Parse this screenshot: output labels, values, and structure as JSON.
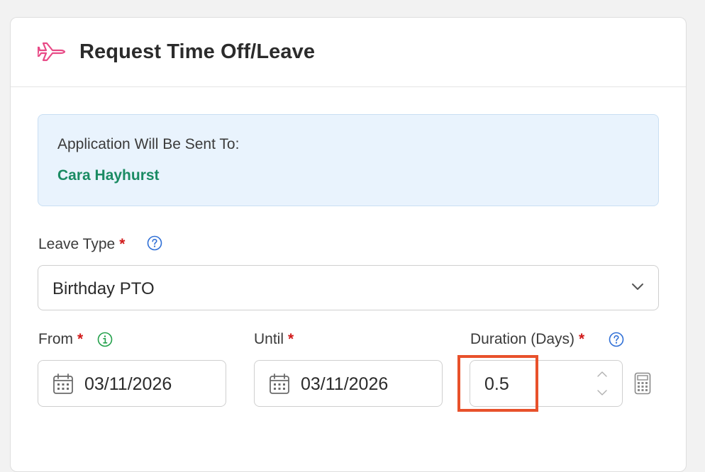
{
  "header": {
    "title": "Request Time Off/Leave",
    "icon": "airplane-icon",
    "icon_color": "#e84a86"
  },
  "recipient": {
    "label": "Application Will Be Sent To:",
    "name": "Cara Hayhurst",
    "name_color": "#1a8b63"
  },
  "leave_type": {
    "label": "Leave Type",
    "required_mark": "*",
    "selected": "Birthday PTO"
  },
  "from": {
    "label": "From",
    "required_mark": "*",
    "value": "03/11/2026"
  },
  "until": {
    "label": "Until",
    "required_mark": "*",
    "value": "03/11/2026"
  },
  "duration": {
    "label": "Duration (Days)",
    "required_mark": "*",
    "value": "0.5"
  },
  "colors": {
    "accent_blue": "#2f6fd6",
    "required_red": "#d11a1a",
    "info_green": "#22a04a",
    "highlight": "#e8512b"
  }
}
